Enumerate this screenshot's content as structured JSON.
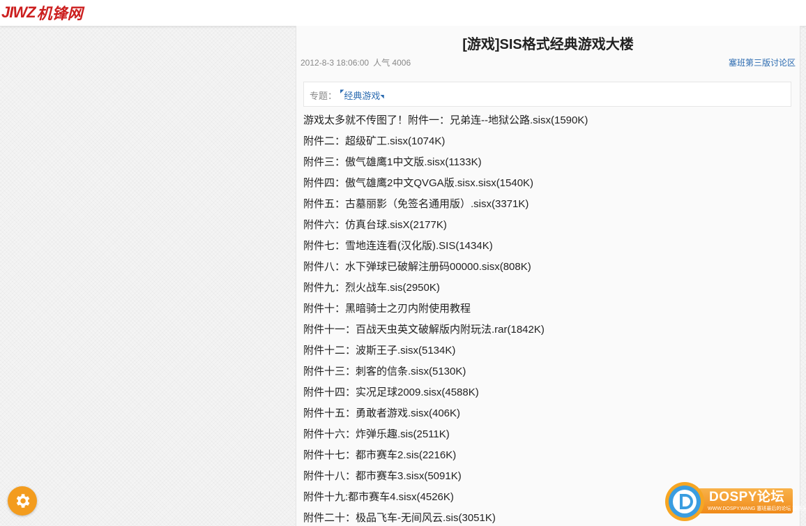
{
  "brand": {
    "logo_latin": "JIWZ",
    "logo_cn": "机锋网",
    "color": "#cc1f1f"
  },
  "article": {
    "title": "[游戏]SIS格式经典游戏大楼",
    "datetime": "2012-8-3 18:06:00",
    "popularity": "人气 4006",
    "forum_link": "塞班第三版讨论区",
    "topic_label": "专题：",
    "topic_tag": "经典游戏",
    "lines": [
      "游戏太多就不传图了！附件一：兄弟连--地狱公路.sisx(1590K)",
      "附件二：超级矿工.sisx(1074K)",
      "附件三：傲气雄鹰1中文版.sisx(1133K)",
      "附件四：傲气雄鹰2中文QVGA版.sisx.sisx(1540K)",
      "附件五：古墓丽影（免签名通用版）.sisx(3371K)",
      "附件六：仿真台球.sisX(2177K)",
      "附件七：雪地连连看(汉化版).SIS(1434K)",
      "附件八：水下弹球已破解注册码00000.sisx(808K)",
      "附件九：烈火战车.sis(2950K)",
      "附件十：黑暗骑士之刃内附使用教程",
      "附件十一：百战天虫英文破解版内附玩法.rar(1842K)",
      "附件十二：波斯王子.sisx(5134K)",
      "附件十三：刺客的信条.sisx(5130K)",
      "附件十四：实况足球2009.sisx(4588K)",
      "附件十五：勇敢者游戏.sisx(406K)",
      "附件十六：炸弹乐趣.sis(2511K)",
      "附件十七：都市赛车2.sis(2216K)",
      "附件十八：都市赛车3.sisx(5091K)",
      "附件十九:都市赛车4.sisx(4526K)",
      "附件二十：极品飞车-无间风云.sis(3051K)"
    ]
  },
  "widgets": {
    "settings_icon": "gear-icon",
    "settings_color": "#f39c1e"
  },
  "watermark": {
    "name": "DOSPY论坛",
    "sub": "WWW.DOSPY.WANG 塞班最后的论坛 塞班无寿命"
  }
}
